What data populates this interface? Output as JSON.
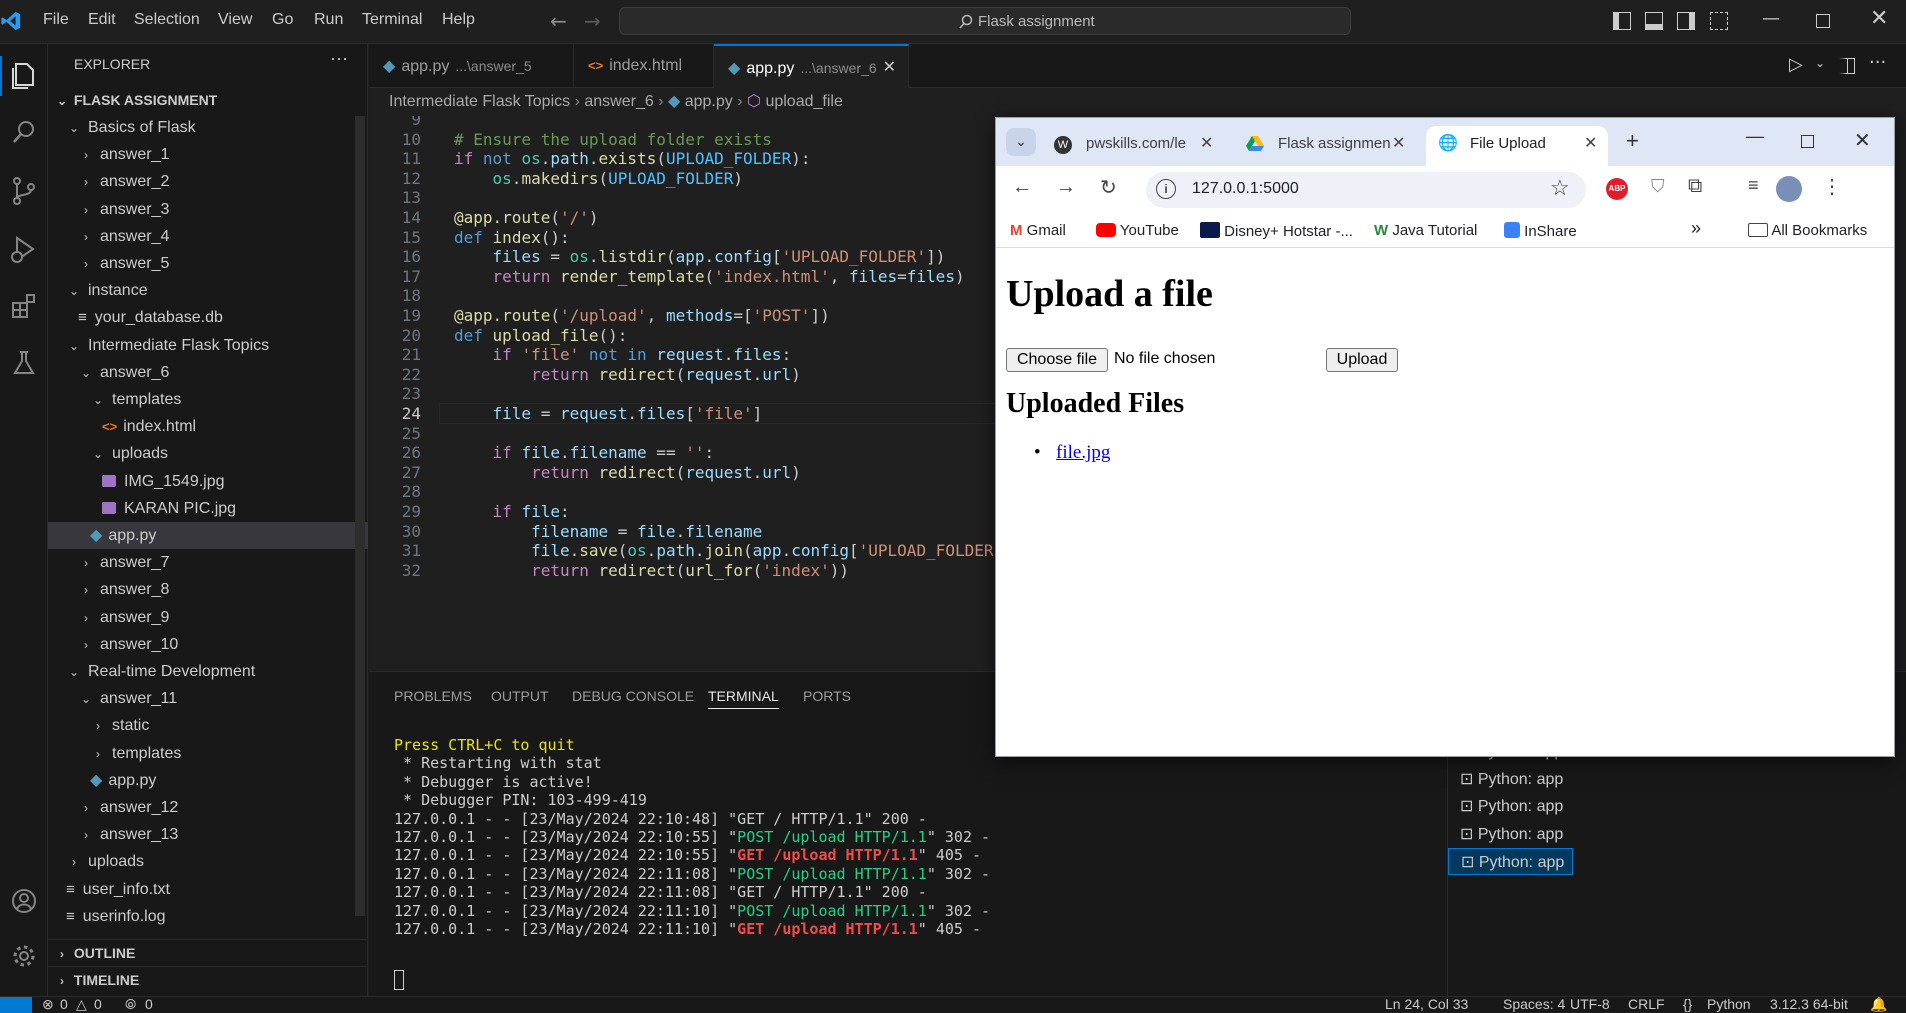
{
  "menu": [
    "File",
    "Edit",
    "Selection",
    "View",
    "Go",
    "Run",
    "Terminal",
    "Help"
  ],
  "command_center": "Flask assignment",
  "sidebar": {
    "title": "EXPLORER",
    "root": "FLASK ASSIGNMENT",
    "items": [
      {
        "label": "Basics of Flask",
        "type": "folder",
        "open": true
      },
      {
        "label": "answer_1",
        "type": "folder"
      },
      {
        "label": "answer_2",
        "type": "folder"
      },
      {
        "label": "answer_3",
        "type": "folder"
      },
      {
        "label": "answer_4",
        "type": "folder"
      },
      {
        "label": "answer_5",
        "type": "folder"
      },
      {
        "label": "instance",
        "type": "folder",
        "open": true
      },
      {
        "label": "your_database.db",
        "type": "file"
      },
      {
        "label": "Intermediate Flask Topics",
        "type": "folder",
        "open": true
      },
      {
        "label": "answer_6",
        "type": "folder",
        "open": true
      },
      {
        "label": "templates",
        "type": "folder",
        "open": true
      },
      {
        "label": "index.html",
        "type": "html"
      },
      {
        "label": "uploads",
        "type": "folder",
        "open": true
      },
      {
        "label": "IMG_1549.jpg",
        "type": "image"
      },
      {
        "label": "KARAN PIC.jpg",
        "type": "image"
      },
      {
        "label": "app.py",
        "type": "python",
        "selected": true
      },
      {
        "label": "answer_7",
        "type": "folder"
      },
      {
        "label": "answer_8",
        "type": "folder"
      },
      {
        "label": "answer_9",
        "type": "folder"
      },
      {
        "label": "answer_10",
        "type": "folder"
      },
      {
        "label": "Real-time Development",
        "type": "folder",
        "open": true
      },
      {
        "label": "answer_11",
        "type": "folder",
        "open": true
      },
      {
        "label": "static",
        "type": "folder"
      },
      {
        "label": "templates",
        "type": "folder"
      },
      {
        "label": "app.py",
        "type": "python"
      },
      {
        "label": "answer_12",
        "type": "folder"
      },
      {
        "label": "answer_13",
        "type": "folder"
      },
      {
        "label": "uploads",
        "type": "folder"
      },
      {
        "label": "user_info.txt",
        "type": "text"
      },
      {
        "label": "userinfo.log",
        "type": "text"
      }
    ],
    "outline": "OUTLINE",
    "timeline": "TIMELINE"
  },
  "tabs": [
    {
      "label": "app.py",
      "desc": "...\\answer_5"
    },
    {
      "label": "index.html",
      "desc": ""
    },
    {
      "label": "app.py",
      "desc": "...\\answer_6",
      "active": true
    }
  ],
  "breadcrumb": [
    "Intermediate Flask Topics",
    "answer_6",
    "app.py",
    "upload_file"
  ],
  "code_lines": [
    {
      "n": "9",
      "html": ""
    },
    {
      "n": "10",
      "html": "<span class='cmt'># Ensure the upload folder exists</span>"
    },
    {
      "n": "11",
      "html": "<span class='kw2'>if</span> <span class='kw'>not</span> <span class='cls'>os</span>.<span class='var'>path</span>.<span class='fn'>exists</span>(<span class='cst'>UPLOAD_FOLDER</span>):"
    },
    {
      "n": "12",
      "html": "    <span class='cls'>os</span>.<span class='fn'>makedirs</span>(<span class='cst'>UPLOAD_FOLDER</span>)"
    },
    {
      "n": "13",
      "html": ""
    },
    {
      "n": "14",
      "html": "<span class='fn'>@app.route</span>(<span class='str'>'/'</span>)"
    },
    {
      "n": "15",
      "html": "<span class='kw'>def</span> <span class='fn'>index</span>():"
    },
    {
      "n": "16",
      "html": "    <span class='var'>files</span> = <span class='cls'>os</span>.<span class='fn'>listdir</span>(<span class='var'>app</span>.<span class='var'>config</span>[<span class='str'>'UPLOAD_FOLDER'</span>])"
    },
    {
      "n": "17",
      "html": "    <span class='kw2'>return</span> <span class='fn'>render_template</span>(<span class='str'>'index.html'</span>, <span class='var'>files</span>=<span class='var'>files</span>)"
    },
    {
      "n": "18",
      "html": ""
    },
    {
      "n": "19",
      "html": "<span class='fn'>@app.route</span>(<span class='str'>'/upload'</span>, <span class='var'>methods</span>=[<span class='str'>'POST'</span>])"
    },
    {
      "n": "20",
      "html": "<span class='kw'>def</span> <span class='fn'>upload_file</span>():"
    },
    {
      "n": "21",
      "html": "    <span class='kw2'>if</span> <span class='str'>'file'</span> <span class='kw'>not in</span> <span class='var'>request</span>.<span class='var'>files</span>:"
    },
    {
      "n": "22",
      "html": "        <span class='kw2'>return</span> <span class='fn'>redirect</span>(<span class='var'>request</span>.<span class='var'>url</span>)"
    },
    {
      "n": "23",
      "html": ""
    },
    {
      "n": "24",
      "html": "    <span class='var'>file</span> = <span class='var'>request</span>.<span class='var'>files</span>[<span class='str'>'file'</span>]",
      "current": true
    },
    {
      "n": "25",
      "html": ""
    },
    {
      "n": "26",
      "html": "    <span class='kw2'>if</span> <span class='var'>file</span>.<span class='var'>filename</span> == <span class='str'>''</span>:"
    },
    {
      "n": "27",
      "html": "        <span class='kw2'>return</span> <span class='fn'>redirect</span>(<span class='var'>request</span>.<span class='var'>url</span>)"
    },
    {
      "n": "28",
      "html": ""
    },
    {
      "n": "29",
      "html": "    <span class='kw2'>if</span> <span class='var'>file</span>:"
    },
    {
      "n": "30",
      "html": "        <span class='var'>filename</span> = <span class='var'>file</span>.<span class='var'>filename</span>"
    },
    {
      "n": "31",
      "html": "        <span class='var'>file</span>.<span class='fn'>save</span>(<span class='cls'>os</span>.<span class='var'>path</span>.<span class='fn'>join</span>(<span class='var'>app</span>.<span class='var'>config</span>[<span class='str'>'UPLOAD_FOLDER</span>"
    },
    {
      "n": "32",
      "html": "        <span class='kw2'>return</span> <span class='fn'>redirect</span>(<span class='fn'>url_for</span>(<span class='str'>'index'</span>))"
    }
  ],
  "panel": {
    "tabs": [
      "PROBLEMS",
      "OUTPUT",
      "DEBUG CONSOLE",
      "TERMINAL",
      "PORTS"
    ],
    "active_tab": "TERMINAL",
    "terminal_lines": [
      {
        "html": "<span class='t-yel'>Press CTRL+C to quit</span>"
      },
      {
        "html": " * Restarting with stat"
      },
      {
        "html": " * Debugger is active!"
      },
      {
        "html": " * Debugger PIN: 103-499-419"
      },
      {
        "html": "127.0.0.1 - - [23/May/2024 22:10:48] \"GET / HTTP/1.1\" 200 -"
      },
      {
        "html": "127.0.0.1 - - [23/May/2024 22:10:55] \"<span class='t-grn'>POST /upload HTTP/1.1</span>\" 302 -"
      },
      {
        "html": "127.0.0.1 - - [23/May/2024 22:10:55] \"<span class='t-red'>GET /upload HTTP/1.1</span>\" 405 -"
      },
      {
        "html": "127.0.0.1 - - [23/May/2024 22:11:08] \"<span class='t-grn'>POST /upload HTTP/1.1</span>\" 302 -"
      },
      {
        "html": "127.0.0.1 - - [23/May/2024 22:11:08] \"GET / HTTP/1.1\" 200 -"
      },
      {
        "html": "127.0.0.1 - - [23/May/2024 22:11:10] \"<span class='t-grn'>POST /upload HTTP/1.1</span>\" 302 -"
      },
      {
        "html": "127.0.0.1 - - [23/May/2024 22:11:10] \"<span class='t-red'>GET /upload HTTP/1.1</span>\" 405 -"
      }
    ],
    "terminal_list": [
      "Python: app",
      "Python: app",
      "Python: app",
      "Python: app",
      "Python: app"
    ]
  },
  "statusbar": {
    "errors": "0",
    "warnings": "0",
    "ports": "0",
    "position": "Ln 24, Col 33",
    "spaces": "Spaces: 4",
    "encoding": "UTF-8",
    "eol": "CRLF",
    "language": "Python",
    "interpreter": "3.12.3 64-bit"
  },
  "browser": {
    "tabs": [
      {
        "label": "pwskills.com/le",
        "icon": "wordpress-icon"
      },
      {
        "label": "Flask assignmen",
        "icon": "google-drive-icon"
      },
      {
        "label": "File Upload",
        "icon": "globe-icon",
        "active": true
      }
    ],
    "url": "127.0.0.1:5000",
    "bookmarks": [
      "Gmail",
      "YouTube",
      "Disney+ Hotstar -...",
      "Java Tutorial",
      "InShare"
    ],
    "all_bookmarks": "All Bookmarks",
    "page": {
      "heading": "Upload a file",
      "choose_file": "Choose file",
      "no_file": "No file chosen",
      "upload": "Upload",
      "subheading": "Uploaded Files",
      "files": [
        "file.jpg"
      ]
    }
  }
}
